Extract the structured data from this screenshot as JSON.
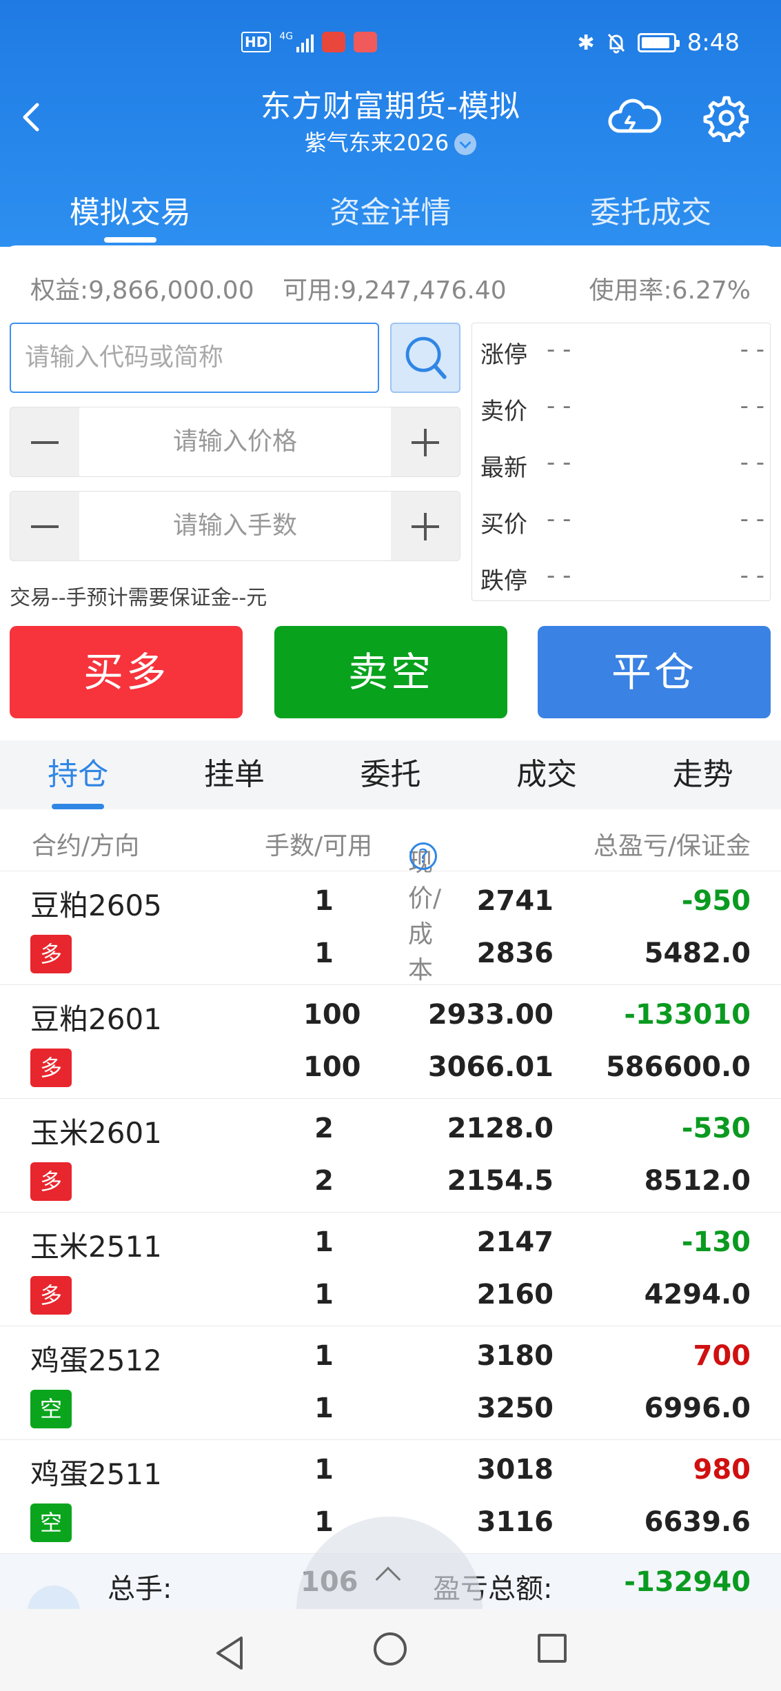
{
  "statusbar": {
    "hd": "HD",
    "signal": "4G",
    "bluetooth": "✱",
    "time": "8:48",
    "battery_level": 0.9
  },
  "header": {
    "title": "东方财富期货-模拟",
    "subtitle": "紫气东来2026",
    "tabs": [
      "模拟交易",
      "资金详情",
      "委托成交"
    ],
    "active_tab": 0
  },
  "account": {
    "equity": "权益:9,866,000.00",
    "available": "可用:9,247,476.40",
    "usage": "使用率:6.27%"
  },
  "order_form": {
    "code_placeholder": "请输入代码或简称",
    "price_placeholder": "请输入价格",
    "qty_placeholder": "请输入手数",
    "margin_note": "交易--手预计需要保证金--元"
  },
  "quote": [
    {
      "label": "涨停",
      "v1": "- -",
      "v2": "- -"
    },
    {
      "label": "卖价",
      "v1": "- -",
      "v2": "- -"
    },
    {
      "label": "最新",
      "v1": "- -",
      "v2": "- -"
    },
    {
      "label": "买价",
      "v1": "- -",
      "v2": "- -"
    },
    {
      "label": "跌停",
      "v1": "- -",
      "v2": "- -"
    }
  ],
  "actions": {
    "buy": "买多",
    "sell": "卖空",
    "close": "平仓"
  },
  "sub_tabs": [
    "持仓",
    "挂单",
    "委托",
    "成交",
    "走势"
  ],
  "table": {
    "headers": [
      "合约/方向",
      "手数/可用",
      "现价/成本",
      "总盈亏/保证金"
    ],
    "help": "?",
    "rows": [
      {
        "name": "豆粕2605",
        "dir": "多",
        "qty": "1",
        "avail": "1",
        "price": "2741",
        "cost": "2836",
        "pnl": "-950",
        "margin": "5482.0"
      },
      {
        "name": "豆粕2601",
        "dir": "多",
        "qty": "100",
        "avail": "100",
        "price": "2933.00",
        "cost": "3066.01",
        "pnl": "-133010",
        "margin": "586600.0"
      },
      {
        "name": "玉米2601",
        "dir": "多",
        "qty": "2",
        "avail": "2",
        "price": "2128.0",
        "cost": "2154.5",
        "pnl": "-530",
        "margin": "8512.0"
      },
      {
        "name": "玉米2511",
        "dir": "多",
        "qty": "1",
        "avail": "1",
        "price": "2147",
        "cost": "2160",
        "pnl": "-130",
        "margin": "4294.0"
      },
      {
        "name": "鸡蛋2512",
        "dir": "空",
        "qty": "1",
        "avail": "1",
        "price": "3180",
        "cost": "3250",
        "pnl": "700",
        "margin": "6996.0"
      },
      {
        "name": "鸡蛋2511",
        "dir": "空",
        "qty": "1",
        "avail": "1",
        "price": "3018",
        "cost": "3116",
        "pnl": "980",
        "margin": "6639.6"
      }
    ]
  },
  "summary": {
    "total_qty_label": "总手:",
    "total_qty": "106",
    "pnl_label": "盈亏总额:",
    "pnl_total": "-132940"
  },
  "colors": {
    "primary": "#2d8ff0",
    "buy": "#f7333c",
    "sell": "#08a21d",
    "close": "#3a82e3",
    "loss": "#0a9a20",
    "profit": "#d01010",
    "long_badge": "#e8262d",
    "short_badge": "#0aa51d"
  }
}
